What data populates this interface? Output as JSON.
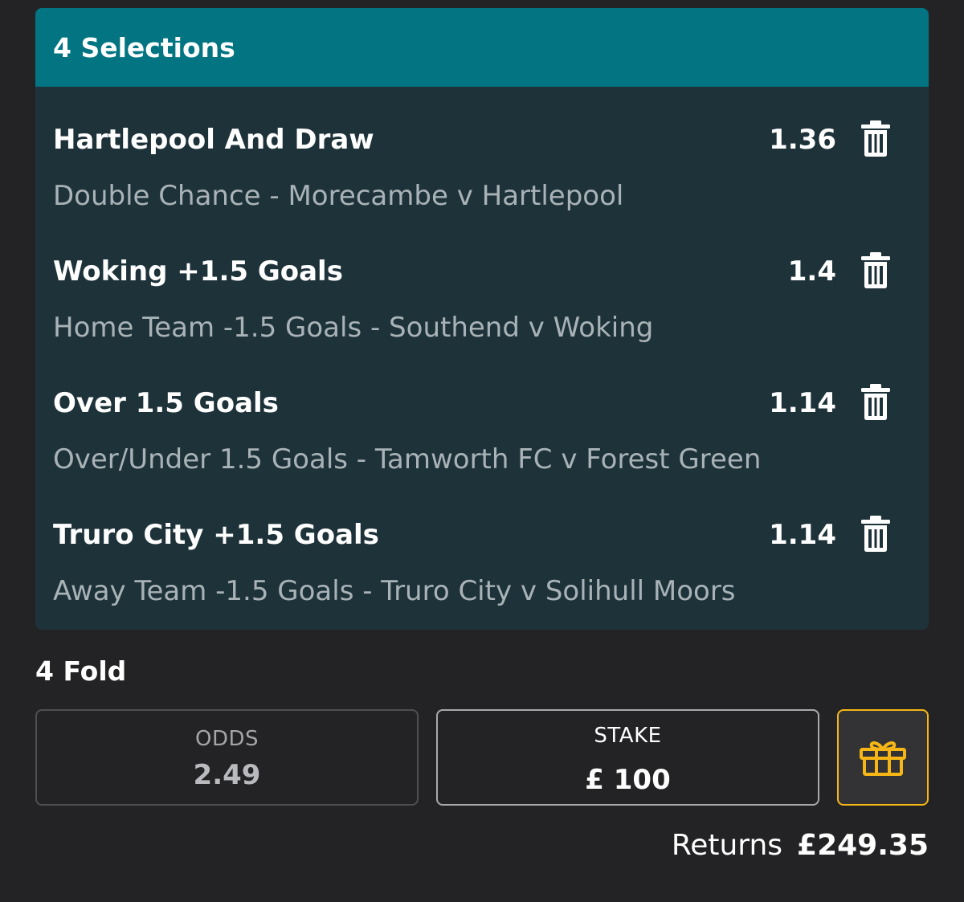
{
  "header": {
    "title": "4 Selections"
  },
  "selections": [
    {
      "name": "Hartlepool And Draw",
      "odds": "1.36",
      "market": "Double Chance - Morecambe v Hartlepool"
    },
    {
      "name": "Woking +1.5 Goals",
      "odds": "1.4",
      "market": "Home Team -1.5 Goals - Southend v Woking"
    },
    {
      "name": "Over 1.5 Goals",
      "odds": "1.14",
      "market": "Over/Under 1.5 Goals - Tamworth FC v Forest Green"
    },
    {
      "name": "Truro City +1.5 Goals",
      "odds": "1.14",
      "market": "Away Team -1.5 Goals - Truro City v Solihull Moors"
    }
  ],
  "fold": {
    "title": "4 Fold",
    "odds_label": "ODDS",
    "odds_value": "2.49",
    "stake_label": "STAKE",
    "stake_value": "£ 100"
  },
  "returns": {
    "label": "Returns",
    "value": "£249.35"
  },
  "icons": {
    "remove": "trash-icon",
    "bonus": "gift-icon"
  },
  "colors": {
    "header": "#027482",
    "panel": "#1e323a",
    "background": "#232325",
    "accent": "#f5b616",
    "muted_text": "#a9b3b7"
  }
}
